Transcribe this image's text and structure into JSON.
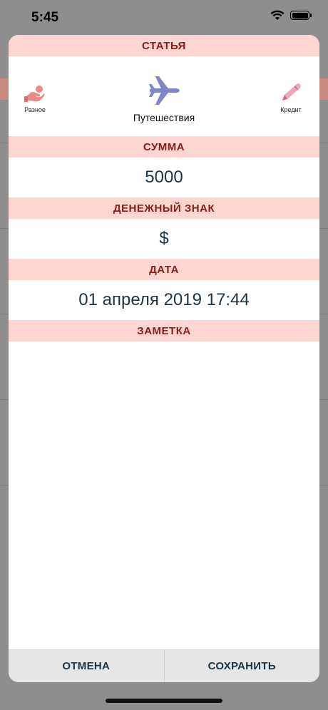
{
  "status": {
    "time": "5:45"
  },
  "sections": {
    "category": "СТАТЬЯ",
    "amount": "СУММА",
    "currency": "ДЕНЕЖНЫЙ ЗНАК",
    "date": "ДАТА",
    "note": "ЗАМЕТКА"
  },
  "categories": {
    "left": {
      "label": "Разное",
      "icon": "hand-coin-icon"
    },
    "center": {
      "label": "Путешествия",
      "icon": "airplane-icon"
    },
    "right": {
      "label": "Кредит",
      "icon": "pen-icon"
    }
  },
  "values": {
    "amount": "5000",
    "currency": "$",
    "date": "01 апреля 2019 17:44"
  },
  "buttons": {
    "cancel": "ОТМЕНА",
    "save": "СОХРАНИТЬ"
  },
  "colors": {
    "header_bg": "#fdd6d2",
    "header_text": "#8a1c1c",
    "value_text": "#1d3445",
    "airplane": "#7e86c9",
    "accent_pink": "#e98a86"
  }
}
